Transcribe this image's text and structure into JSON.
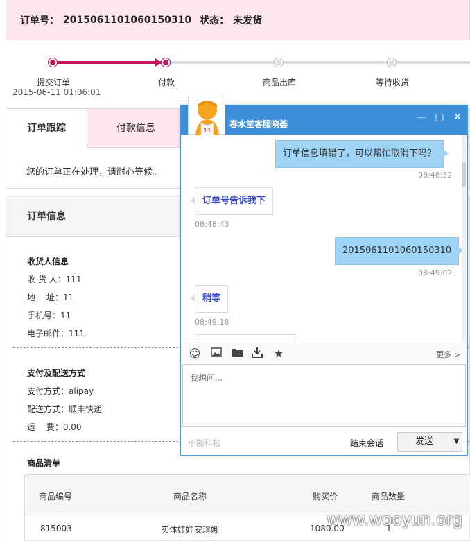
{
  "order": {
    "label": "订单号：",
    "number": "2015061101060150310",
    "status_label": "状态：",
    "status": "未发货"
  },
  "progress": {
    "steps": [
      "提交订单",
      "付款",
      "商品出库",
      "等待收货"
    ],
    "submit_time": "2015-06-11 01:06:01"
  },
  "tabs": {
    "tracking": "订单跟踪",
    "payment": "付款信息",
    "message": "您的订单正在处理，请耐心等候。"
  },
  "info": {
    "title": "订单信息",
    "receiver_title": "收货人信息",
    "receiver": [
      "收 货 人：111",
      "地　 址：11",
      "手机号：11",
      "电子邮件：111"
    ],
    "delivery_title": "支付及配送方式",
    "delivery": [
      "支付方式：alipay",
      "配送方式：顺丰快递",
      "运　 费：0.00"
    ],
    "goods_title": "商品清单",
    "goods_headers": [
      "商品编号",
      "商品名称",
      "购买价",
      "商品数量"
    ],
    "goods_rows": [
      [
        "815003",
        "实体娃娃安琪娜",
        "1080.00",
        "1"
      ]
    ]
  },
  "chat": {
    "title": "春水堂客服晓荟",
    "messages": [
      {
        "dir": "out",
        "text": "订单信息填错了，可以帮忙取消下吗？",
        "time": "08:48:32"
      },
      {
        "dir": "in",
        "text": "订单号告诉我下",
        "time": "08:48:43"
      },
      {
        "dir": "out",
        "text": "2015061101060150310",
        "time": "08:49:02"
      },
      {
        "dir": "in",
        "text": "稍等",
        "time": "08:49:18"
      }
    ],
    "more": "更多 >",
    "placeholder": "我想问...",
    "brand": "小能科技",
    "end_label": "结束会话",
    "send_label": "发送"
  },
  "watermark": "www.wooyun.org",
  "colors": {
    "accent": "#c2185b",
    "pink_bg": "#fde6ee",
    "chat_blue": "#3d8fdb"
  }
}
